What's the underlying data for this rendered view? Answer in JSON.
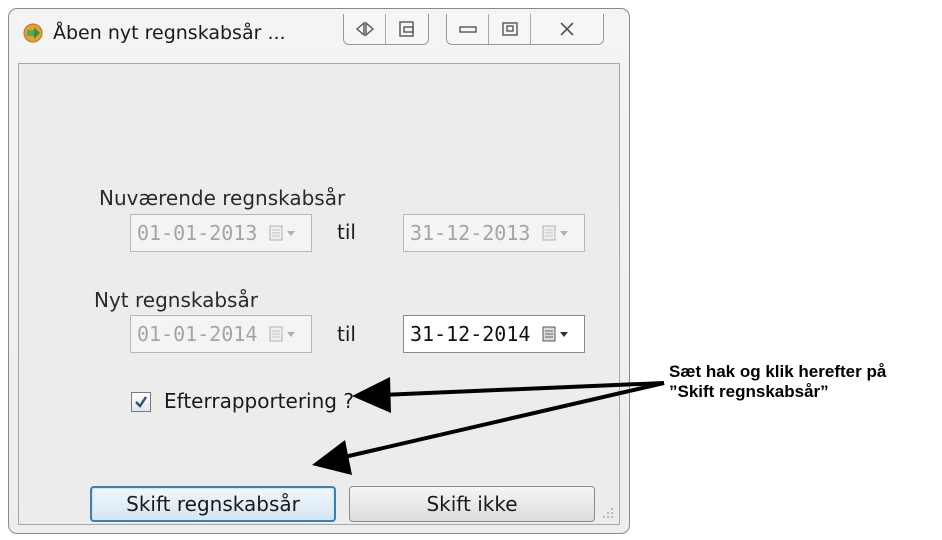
{
  "window": {
    "title": "Åben nyt regnskabsår ...",
    "controls": [
      "resize-horizontal-icon",
      "dock-icon",
      "minimize-icon",
      "maximize-icon",
      "close-icon"
    ]
  },
  "current_year": {
    "label": "Nuværende regnskabsår",
    "from": "01-01-2013",
    "to_label": "til",
    "to": "31-12-2013",
    "enabled": false
  },
  "new_year": {
    "label": "Nyt regnskabsår",
    "from": "01-01-2014",
    "to_label": "til",
    "to": "31-12-2014"
  },
  "late_reporting": {
    "label": "Efterrapportering ?",
    "checked": true
  },
  "buttons": {
    "switch": "Skift regnskabsår",
    "cancel": "Skift ikke"
  },
  "annotation": {
    "line1": "Sæt hak og klik herefter på",
    "line2": "”Skift regnskabsår”"
  },
  "colors": {
    "primary_button_border": "#3c7fb1",
    "window_background": "#ececec"
  }
}
